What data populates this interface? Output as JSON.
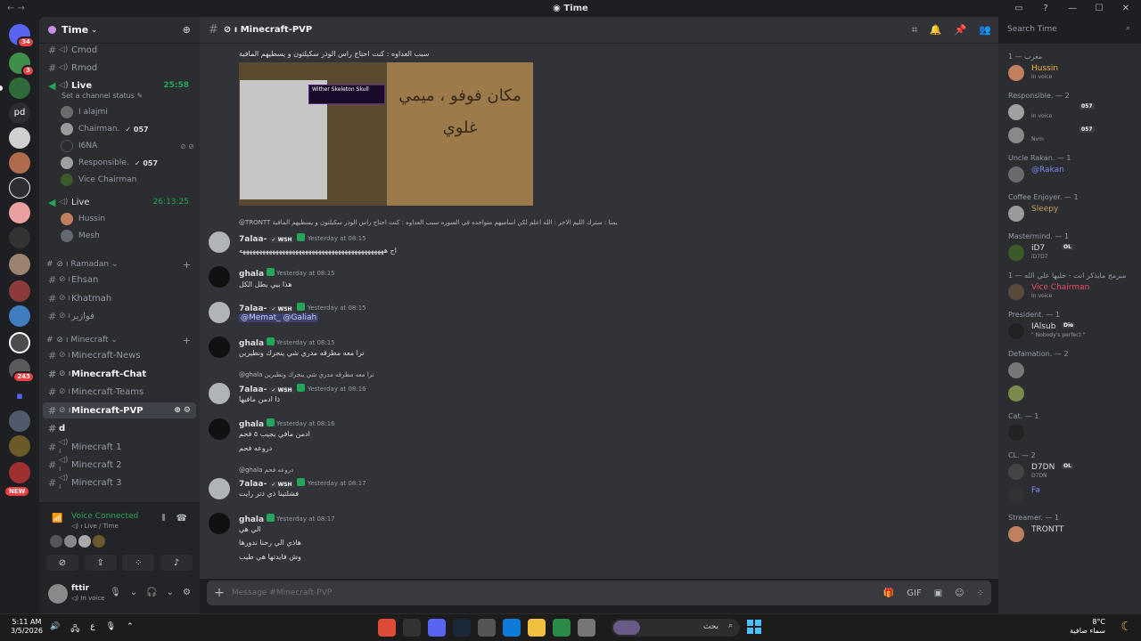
{
  "window": {
    "title": "Time"
  },
  "rail": {
    "badges": {
      "home": "34",
      "s2": "3",
      "s_243": "243",
      "new": "NEW"
    },
    "pd_label": "pd"
  },
  "guild": {
    "name": "Time"
  },
  "channels": {
    "cmod": "Cmod",
    "rmod": "Rmod",
    "live1": "Live",
    "live1_time": "25:58",
    "live1_status": "Set a channel status",
    "live1_users": [
      {
        "name": "I alajmi",
        "tag": ""
      },
      {
        "name": "Chairman.",
        "tag": "057"
      },
      {
        "name": "I6NA",
        "tag": ""
      },
      {
        "name": "Responsible.",
        "tag": "057"
      },
      {
        "name": "Vice Chairman",
        "tag": ""
      }
    ],
    "live2": "Live",
    "live2_time": "26:13:25",
    "live2_users": [
      {
        "name": "Hussin"
      },
      {
        "name": "Mesh"
      }
    ],
    "cat_ramadan": "Ramadan",
    "ehsan": "Ehsan",
    "khatmah": "Khatmah",
    "fawazeer": "فوازير",
    "cat_minecraft": "Minecraft",
    "mc_news": "Minecraft-News",
    "mc_chat": "Minecraft-Chat",
    "mc_teams": "Minecraft-Teams",
    "mc_pvp": "Minecraft-PVP",
    "d": "d",
    "mc1": "Minecraft 1",
    "mc2": "Minecraft 2",
    "mc3": "Minecraft 3"
  },
  "voice": {
    "title": "Voice Connected",
    "sub": "Live / Time"
  },
  "user": {
    "name": "fttir",
    "status": "In voice"
  },
  "header": {
    "channel": "Minecraft-PVP",
    "search_placeholder": "Search Time"
  },
  "chat": {
    "top_text": "سبب العداوه : كنت احتاج راس الوذر سكيلتون و يسطيهم المافية",
    "image_tooltip": "Wither Skeleton Skull",
    "image_sign": "مكان فوفو ، ميمي غلوي",
    "messages": [
      {
        "reply": "@TRONTT  يمنا : سترك الليم الاخر : الله اعلم لكن اساميهم متواجده في السوره سبب العداوه : كنت احتاج راس الوذر سكيلتون و يسطيهم المافية",
        "author": "7alaa-",
        "badge": "WSH",
        "time": "Yesterday at 08:15",
        "lines": [
          "اح ههههههههههههههههههههههههههههههههههههههههههههه"
        ]
      },
      {
        "reply": "",
        "author": "ghala",
        "badge": "",
        "time": "Yesterday at 08:15",
        "lines": [
          "هذا بيي يطل الكل"
        ]
      },
      {
        "reply": "",
        "author": "7alaa-",
        "badge": "WSH",
        "time": "Yesterday at 08:15",
        "lines": [
          "@Memat_ @Galiah"
        ]
      },
      {
        "reply": "",
        "author": "ghala",
        "badge": "",
        "time": "Yesterday at 08:15",
        "lines": [
          "ترا معه مطرقه مدري شي ينجرك ونطيرين"
        ]
      },
      {
        "reply": "@ghala  ترا معه مطرقه مدري شي ينجرك ونطيرين",
        "author": "7alaa-",
        "badge": "WSH",
        "time": "Yesterday at 08:16",
        "lines": [
          "ذا ادمن مافيها"
        ]
      },
      {
        "reply": "",
        "author": "ghala",
        "badge": "",
        "time": "Yesterday at 08:16",
        "lines": [
          "ادمن مافي يجيب ٥ فحم",
          "دروعه فحم"
        ]
      },
      {
        "reply": "@ghala  دروعه فحم",
        "author": "7alaa-",
        "badge": "WSH",
        "time": "Yesterday at 08:17",
        "lines": [
          "فشلتينا ذي ذتر رايت"
        ]
      },
      {
        "reply": "",
        "author": "ghala",
        "badge": "",
        "time": "Yesterday at 08:17",
        "lines": [
          "الي هي",
          "هاذي الي رحنا ندورها",
          "وش فايدتها هي طيب"
        ]
      }
    ],
    "composer_placeholder": "Message #Minecraft-PVP"
  },
  "members": {
    "groups": [
      {
        "title": "مغرب — 1",
        "members": [
          {
            "name": "Hussin",
            "sub": "In voice",
            "color": "#f0b232"
          }
        ]
      },
      {
        "title": "Responsible. — 2",
        "members": [
          {
            "name": "",
            "sub": "In voice",
            "color": "#dbdee1",
            "tag": "057"
          },
          {
            "name": "",
            "sub": "Nvm",
            "color": "#dbdee1",
            "tag": "057"
          }
        ]
      },
      {
        "title": "Uncle Rakan. — 1",
        "members": [
          {
            "name": "@Rakan",
            "sub": "",
            "color": "#7b89f5"
          }
        ]
      },
      {
        "title": "Coffee Enjoyer. — 1",
        "members": [
          {
            "name": "Sleepy",
            "sub": "",
            "color": "#c6a15b"
          }
        ]
      },
      {
        "title": "Mastermind. — 1",
        "members": [
          {
            "name": "iD7",
            "sub": "iD7D7",
            "color": "#dbdee1",
            "tag": "OL"
          }
        ]
      },
      {
        "title": "مبرمج مايذكر انت - خليها علي الله — 1",
        "members": [
          {
            "name": "Vice Chairman",
            "sub": "In voice",
            "color": "#e84d6a"
          }
        ]
      },
      {
        "title": "President. — 1",
        "members": [
          {
            "name": "IAlsub",
            "sub": "\" Nobody's perfect \"",
            "color": "#dbdee1",
            "tag": "Die"
          }
        ]
      },
      {
        "title": "Defamation. — 2",
        "members": [
          {
            "name": "",
            "sub": "",
            "color": "#dbdee1"
          },
          {
            "name": "",
            "sub": "",
            "color": "#dbdee1"
          }
        ]
      },
      {
        "title": "Cat. — 1",
        "members": [
          {
            "name": "",
            "sub": "",
            "color": "#b57edc"
          }
        ]
      },
      {
        "title": "CL. — 2",
        "members": [
          {
            "name": "D7DN",
            "sub": "D7DN",
            "color": "#dbdee1",
            "tag": "OL"
          },
          {
            "name": "Fa",
            "sub": "",
            "color": "#7b89f5"
          }
        ]
      },
      {
        "title": "Streamer. — 1",
        "members": [
          {
            "name": "TRONTT",
            "sub": "",
            "color": "#dbdee1"
          }
        ]
      }
    ]
  },
  "taskbar": {
    "time": "5:11 AM",
    "date": "3/5/2026",
    "lang": "ع",
    "search": "بحث",
    "temp": "8°C",
    "weather": "سماء صافية"
  },
  "colors": {
    "accent": "#5865f2",
    "online": "#23a55a",
    "bg": "#313338"
  }
}
